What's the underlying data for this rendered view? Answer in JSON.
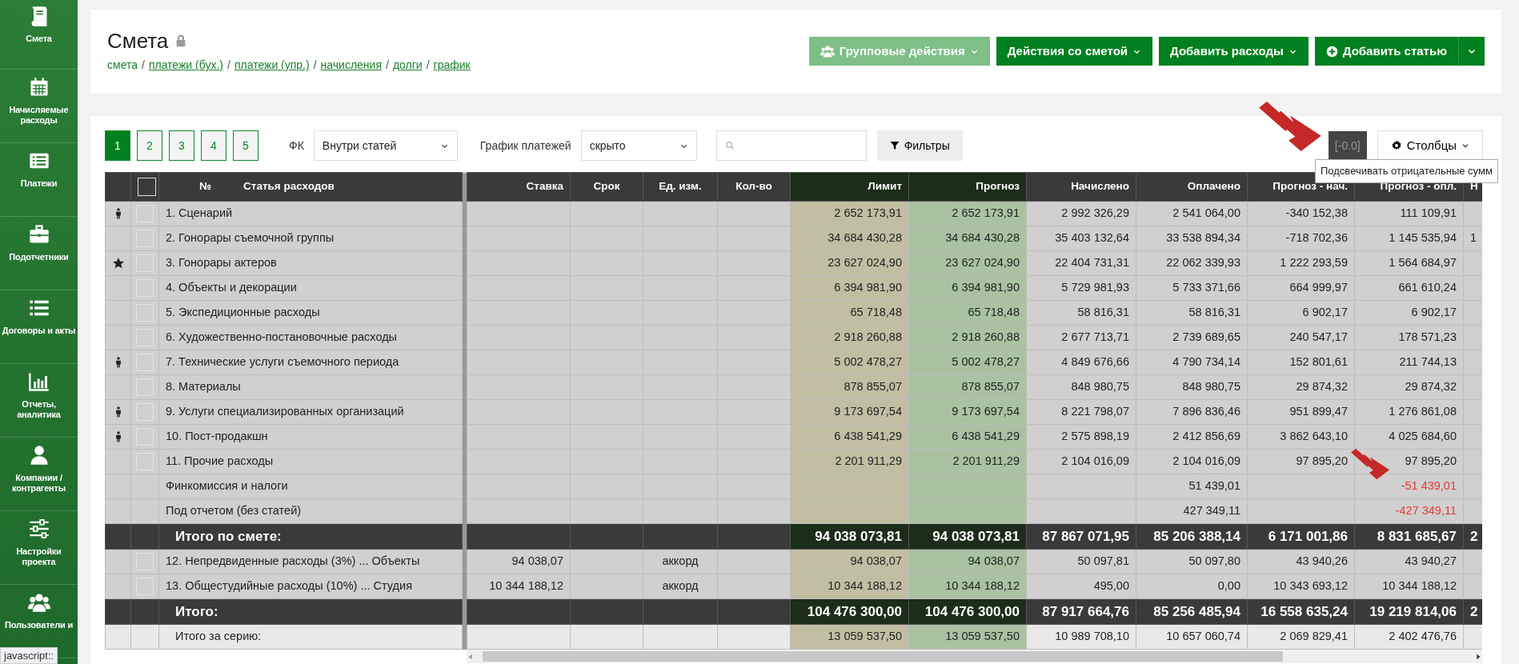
{
  "sidebar": {
    "items": [
      {
        "label": "Смета"
      },
      {
        "label": "Начисляемые расходы"
      },
      {
        "label": "Платежи"
      },
      {
        "label": "Подотчетники"
      },
      {
        "label": "Договоры и акты"
      },
      {
        "label": "Отчеты, аналитика"
      },
      {
        "label": "Компании / контрагенты"
      },
      {
        "label": "Настройки проекта"
      },
      {
        "label": "Пользователи и"
      }
    ]
  },
  "header": {
    "title": "Смета",
    "locked": true,
    "breadcrumb_separator": "/",
    "breadcrumbs": [
      {
        "label": "смета",
        "selected": true
      },
      {
        "label": "платежи (бух.)",
        "selected": false
      },
      {
        "label": "платежи (упр.)",
        "selected": false
      },
      {
        "label": "начисления",
        "selected": false
      },
      {
        "label": "долги",
        "selected": false
      },
      {
        "label": "график",
        "selected": false
      }
    ],
    "buttons": [
      {
        "label": "Групповые действия",
        "kind": "group",
        "disabled": true
      },
      {
        "label": "Действия со сметой",
        "kind": "menu",
        "disabled": false
      },
      {
        "label": "Добавить расходы",
        "kind": "menu",
        "disabled": false
      },
      {
        "label": "Добавить статью",
        "kind": "split",
        "disabled": false
      }
    ]
  },
  "toolbar": {
    "pages": [
      {
        "label": "1",
        "selected": true
      },
      {
        "label": "2",
        "selected": false
      },
      {
        "label": "3",
        "selected": false
      },
      {
        "label": "4",
        "selected": false
      },
      {
        "label": "5",
        "selected": false
      }
    ],
    "fk": {
      "label": "ФК",
      "value": "Внутри статей"
    },
    "schedule": {
      "label": "График платежей",
      "value": "скрыто"
    },
    "filters_button": "Фильтры",
    "negative_toggle": "[-0.0]",
    "columns_button": "Столбцы",
    "tooltip": "Подсвечивать отрицательные сумм"
  },
  "table": {
    "header_checked": false,
    "number_label": "№",
    "name_label": "Статья расходов",
    "columns": [
      "Ставка",
      "Срок",
      "Ед. изм.",
      "Кол-во",
      "Лимит",
      "Прогноз",
      "Начислено",
      "Оплачено",
      "Прогноз - нач.",
      "Прогноз - опл.",
      "Н"
    ],
    "rows": [
      {
        "kind": "item",
        "person": true,
        "starred": false,
        "checked": false,
        "name": "1. Сценарий",
        "negative_highlight": false,
        "cells": [
          null,
          null,
          null,
          null,
          "2 652 173,91",
          "2 652 173,91",
          "2 992 326,29",
          "2 541 064,00",
          "-340 152,38",
          "111 109,91",
          null
        ]
      },
      {
        "kind": "item",
        "person": false,
        "starred": false,
        "checked": false,
        "name": "2. Гонорары съемочной группы",
        "negative_highlight": false,
        "cells": [
          null,
          null,
          null,
          null,
          "34 684 430,28",
          "34 684 430,28",
          "35 403 132,64",
          "33 538 894,34",
          "-718 702,36",
          "1 145 535,94",
          "1"
        ]
      },
      {
        "kind": "item",
        "person": false,
        "starred": true,
        "checked": false,
        "name": "3. Гонорары актеров",
        "negative_highlight": false,
        "cells": [
          null,
          null,
          null,
          null,
          "23 627 024,90",
          "23 627 024,90",
          "22 404 731,31",
          "22 062 339,93",
          "1 222 293,59",
          "1 564 684,97",
          null
        ]
      },
      {
        "kind": "item",
        "person": false,
        "starred": false,
        "checked": false,
        "name": "4. Объекты и декорации",
        "negative_highlight": false,
        "cells": [
          null,
          null,
          null,
          null,
          "6 394 981,90",
          "6 394 981,90",
          "5 729 981,93",
          "5 733 371,66",
          "664 999,97",
          "661 610,24",
          null
        ]
      },
      {
        "kind": "item",
        "person": false,
        "starred": false,
        "checked": false,
        "name": "5. Экспедиционные расходы",
        "negative_highlight": false,
        "cells": [
          null,
          null,
          null,
          null,
          "65 718,48",
          "65 718,48",
          "58 816,31",
          "58 816,31",
          "6 902,17",
          "6 902,17",
          null
        ]
      },
      {
        "kind": "item",
        "person": false,
        "starred": false,
        "checked": false,
        "name": "6. Художественно-постановочные расходы",
        "negative_highlight": false,
        "cells": [
          null,
          null,
          null,
          null,
          "2 918 260,88",
          "2 918 260,88",
          "2 677 713,71",
          "2 739 689,65",
          "240 547,17",
          "178 571,23",
          null
        ]
      },
      {
        "kind": "item",
        "person": true,
        "starred": false,
        "checked": false,
        "name": "7. Технические услуги съемочного периода",
        "negative_highlight": false,
        "cells": [
          null,
          null,
          null,
          null,
          "5 002 478,27",
          "5 002 478,27",
          "4 849 676,66",
          "4 790 734,14",
          "152 801,61",
          "211 744,13",
          null
        ]
      },
      {
        "kind": "item",
        "person": false,
        "starred": false,
        "checked": false,
        "name": "8. Материалы",
        "negative_highlight": false,
        "cells": [
          null,
          null,
          null,
          null,
          "878 855,07",
          "878 855,07",
          "848 980,75",
          "848 980,75",
          "29 874,32",
          "29 874,32",
          null
        ]
      },
      {
        "kind": "item",
        "person": true,
        "starred": false,
        "checked": false,
        "name": "9. Услуги специализированных организаций",
        "negative_highlight": false,
        "cells": [
          null,
          null,
          null,
          null,
          "9 173 697,54",
          "9 173 697,54",
          "8 221 798,07",
          "7 896 836,46",
          "951 899,47",
          "1 276 861,08",
          null
        ]
      },
      {
        "kind": "item",
        "person": true,
        "starred": false,
        "checked": false,
        "name": "10. Пост-продакшн",
        "negative_highlight": false,
        "cells": [
          null,
          null,
          null,
          null,
          "6 438 541,29",
          "6 438 541,29",
          "2 575 898,19",
          "2 412 856,69",
          "3 862 643,10",
          "4 025 684,60",
          null
        ]
      },
      {
        "kind": "item",
        "person": false,
        "starred": false,
        "checked": false,
        "name": "11. Прочие расходы",
        "negative_highlight": false,
        "cells": [
          null,
          null,
          null,
          null,
          "2 201 911,29",
          "2 201 911,29",
          "2 104 016,09",
          "2 104 016,09",
          "97 895,20",
          "97 895,20",
          null
        ]
      },
      {
        "kind": "extra",
        "name": "Финкомиссия и налоги",
        "negative_highlight": true,
        "cells": [
          null,
          null,
          null,
          null,
          null,
          null,
          null,
          "51 439,01",
          null,
          "-51 439,01",
          null
        ]
      },
      {
        "kind": "extra",
        "name": "Под отчетом (без статей)",
        "negative_highlight": true,
        "cells": [
          null,
          null,
          null,
          null,
          null,
          null,
          null,
          "427 349,11",
          null,
          "-427 349,11",
          null
        ]
      },
      {
        "kind": "total",
        "name": "Итого по смете:",
        "negative_highlight": false,
        "cells": [
          null,
          null,
          null,
          null,
          "94 038 073,81",
          "94 038 073,81",
          "87 867 071,95",
          "85 206 388,14",
          "6 171 001,86",
          "8 831 685,67",
          "2"
        ]
      },
      {
        "kind": "item",
        "person": false,
        "starred": false,
        "checked": false,
        "name": "12. Непредвиденные расходы (3%) ... Объекты",
        "negative_highlight": false,
        "cells": [
          "94 038,07",
          null,
          "аккорд",
          null,
          "94 038,07",
          "94 038,07",
          "50 097,81",
          "50 097,80",
          "43 940,26",
          "43 940,27",
          null
        ]
      },
      {
        "kind": "item",
        "person": false,
        "starred": false,
        "checked": false,
        "name": "13. Общестудийные расходы (10%) ... Студия",
        "negative_highlight": false,
        "cells": [
          "10 344 188,12",
          null,
          "аккорд",
          null,
          "10 344 188,12",
          "10 344 188,12",
          "495,00",
          "0,00",
          "10 343 693,12",
          "10 344 188,12",
          null
        ]
      },
      {
        "kind": "total",
        "name": "Итого:",
        "negative_highlight": false,
        "cells": [
          null,
          null,
          null,
          null,
          "104 476 300,00",
          "104 476 300,00",
          "87 917 664,76",
          "85 256 485,94",
          "16 558 635,24",
          "19 219 814,06",
          "2"
        ]
      },
      {
        "kind": "series",
        "name": "Итого за серию:",
        "negative_highlight": false,
        "cells": [
          null,
          null,
          null,
          null,
          "13 059 537,50",
          "13 059 537,50",
          "10 989 708,10",
          "10 657 060,74",
          "2 069 829,41",
          "2 402 476,76",
          null
        ]
      }
    ]
  },
  "status_bar": "javascript::"
}
